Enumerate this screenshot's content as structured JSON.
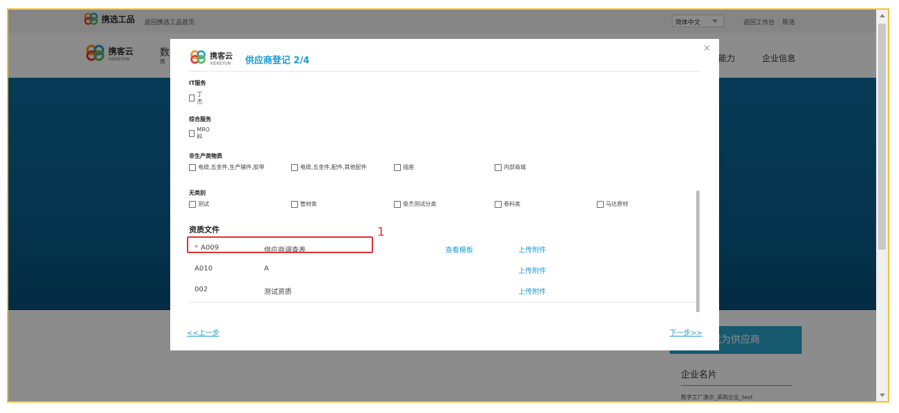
{
  "colors": {
    "accent": "#1a9bd7",
    "highlight": "#e03030",
    "banner": "#0b6a9d",
    "frame": "#f2c12e"
  },
  "topbar": {
    "logo_text": "携选工品",
    "back_home": "返回携选工品首页",
    "language": "简体中文",
    "back_workbench": "返回工作台",
    "user": "陈浩"
  },
  "navbar": {
    "logo_text": "携客云",
    "logo_sub": "XIEKEYUN",
    "title_fragment": "数",
    "title_fragment2": "携",
    "nav_item_1": "能力",
    "nav_item_2": "企业信息"
  },
  "sidebar": {
    "cta": "成为供应商",
    "card_title": "企业名片",
    "card_sub": "数字工厂演示_采购企业_test"
  },
  "modal": {
    "logo_text": "携客云",
    "logo_sub": "XIEKEYUN",
    "title": "供应商登记 2/4",
    "close": "×",
    "categories": [
      {
        "title": "IT服务",
        "items": [
          "丁杰"
        ]
      },
      {
        "title": "综合服务",
        "items": [
          "MRO料"
        ]
      },
      {
        "title": "非生产类物质",
        "items": [
          "电缆,五金件,生产辅件,胶带",
          "电缆,五金件,配件,其他配件",
          "插座",
          "内部商城"
        ]
      },
      {
        "title": "无类别",
        "items": [
          "测试",
          "管材类",
          "俊杰测试分类",
          "卷料类",
          "马达原材"
        ]
      }
    ],
    "docs_title": "资质文件",
    "docs": [
      {
        "required": "*",
        "code": "A009",
        "name": "供应商调查表",
        "template": "查看模板",
        "upload": "上传附件"
      },
      {
        "required": "",
        "code": "A010",
        "name": "A",
        "template": "",
        "upload": "上传附件"
      },
      {
        "required": "",
        "code": "002",
        "name": "测试资质",
        "template": "",
        "upload": "上传附件"
      }
    ],
    "annotation": "1",
    "prev": "<<上一步",
    "next": "下一步>>"
  }
}
